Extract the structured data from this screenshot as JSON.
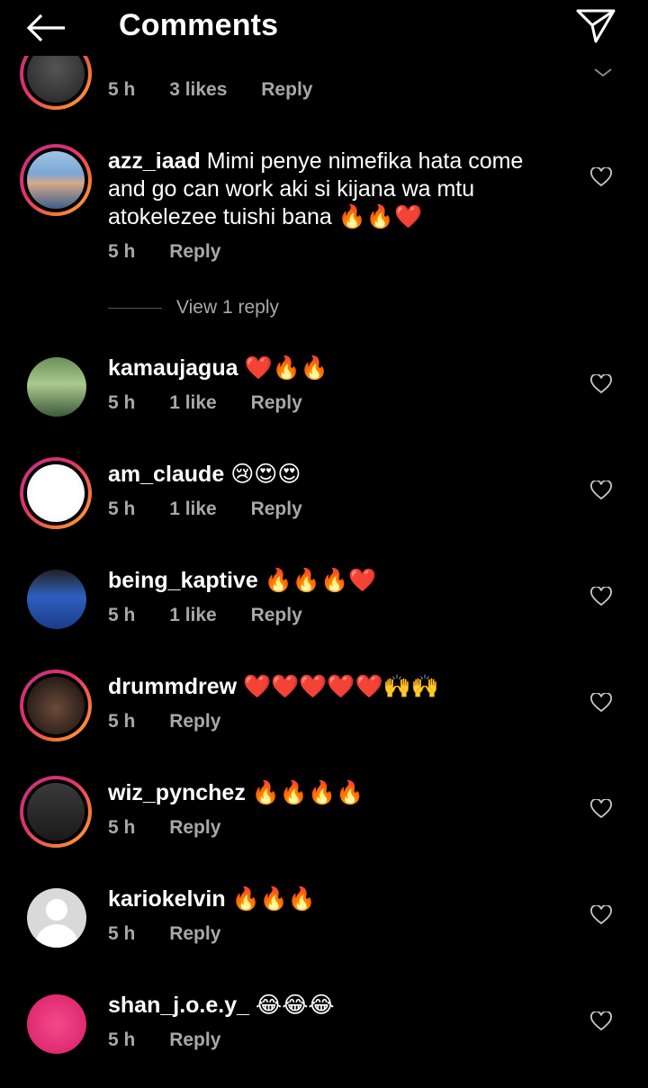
{
  "header": {
    "title": "Comments",
    "back_icon": "arrow-left-icon",
    "send_icon": "paper-plane-icon"
  },
  "top_partial": {
    "time": "5 h",
    "likes": "3 likes",
    "reply": "Reply"
  },
  "comments": [
    {
      "username": "azz_iaad",
      "text": "Mimi penye nimefika hata come and go can work aki si kijana wa mtu atokelezee tuishi bana 🔥🔥❤️",
      "time": "5 h",
      "likes": "",
      "reply": "Reply",
      "view_replies": "View 1 reply"
    },
    {
      "username": "kamaujagua",
      "text": "❤️🔥🔥",
      "time": "5 h",
      "likes": "1 like",
      "reply": "Reply"
    },
    {
      "username": "am_claude",
      "text": "😢😍😍",
      "time": "5 h",
      "likes": "1 like",
      "reply": "Reply"
    },
    {
      "username": "being_kaptive",
      "text": "🔥🔥🔥❤️",
      "time": "5 h",
      "likes": "1 like",
      "reply": "Reply"
    },
    {
      "username": "drummdrew",
      "text": "❤️❤️❤️❤️❤️🙌🙌",
      "time": "5 h",
      "likes": "",
      "reply": "Reply"
    },
    {
      "username": "wiz_pynchez",
      "text": "🔥🔥🔥🔥",
      "time": "5 h",
      "likes": "",
      "reply": "Reply"
    },
    {
      "username": "kariokelvin",
      "text": "🔥🔥🔥",
      "time": "5 h",
      "likes": "",
      "reply": "Reply"
    },
    {
      "username": "shan_j.o.e.y_",
      "text": "😂😂😂",
      "time": "5 h",
      "likes": "",
      "reply": "Reply"
    }
  ],
  "colors": {
    "background": "#000000",
    "meta_text": "#a8a8a8",
    "story_ring": [
      "#c13584",
      "#f77737"
    ]
  }
}
